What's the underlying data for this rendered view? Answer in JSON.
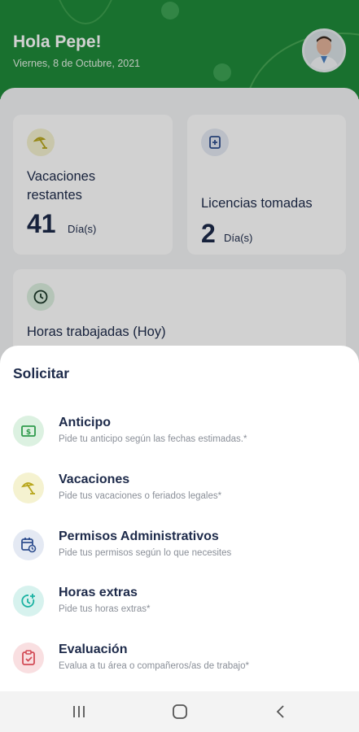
{
  "header": {
    "greeting": "Hola Pepe!",
    "date": "Viernes, 8 de Octubre, 2021"
  },
  "cards": {
    "vacaciones": {
      "title": "Vacaciones restantes",
      "value": "41",
      "unit": "Día(s)",
      "icon": "beach-umbrella-icon"
    },
    "licencias": {
      "title": "Licencias tomadas",
      "value": "2",
      "unit": "Día(s)",
      "icon": "medical-license-icon"
    },
    "horas": {
      "title": "Horas trabajadas (Hoy)",
      "icon": "clock-icon"
    }
  },
  "sheet": {
    "title": "Solicitar",
    "options": [
      {
        "title": "Anticipo",
        "subtitle": "Pide tu anticipo según las fechas estimadas.*",
        "icon": "money-bill-icon",
        "color": "#2e9a4b"
      },
      {
        "title": "Vacaciones",
        "subtitle": "Pide tus vacaciones o feriados legales*",
        "icon": "beach-umbrella-icon",
        "color": "#b8a61c"
      },
      {
        "title": "Permisos Administrativos",
        "subtitle": "Pide tus permisos según lo que necesites",
        "icon": "calendar-clock-icon",
        "color": "#2f4f8f"
      },
      {
        "title": "Horas extras",
        "subtitle": "Pide tus horas extras*",
        "icon": "clock-plus-icon",
        "color": "#1bb2a2"
      },
      {
        "title": "Evaluación",
        "subtitle": "Evalua a tu área o compañeros/as de trabajo*",
        "icon": "clipboard-check-icon",
        "color": "#d24b56"
      }
    ]
  },
  "navbar": {
    "icons": [
      "recent-apps-icon",
      "home-icon",
      "back-icon"
    ]
  }
}
